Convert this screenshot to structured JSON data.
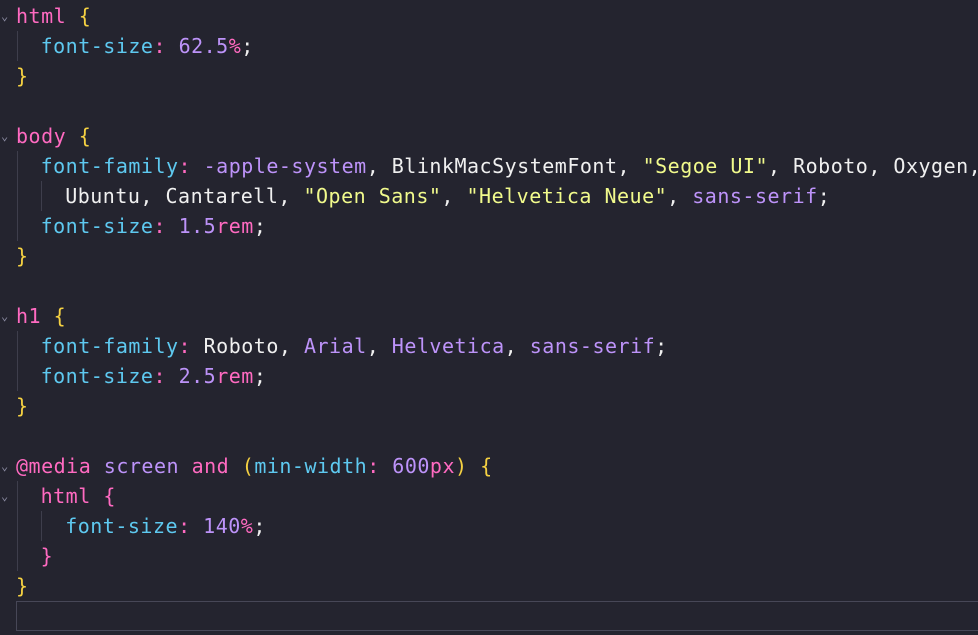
{
  "colors": {
    "background": "#24242f",
    "default": "#f0f0f0",
    "selector": "#ff6ac1",
    "brace": "#f5d142",
    "property": "#5ec9f0",
    "number": "#bd93f9",
    "unit": "#ff6ac1",
    "keyword": "#bd93f9",
    "string": "#f1fa8c",
    "at_rule": "#ff6ac1",
    "operator": "#ff6ac1",
    "paren": "#f5d142"
  },
  "lines": [
    {
      "indent": 0,
      "fold": true,
      "tokens": [
        {
          "t": "html",
          "k": "selector"
        },
        {
          "t": " "
        },
        {
          "t": "{",
          "k": "brace"
        }
      ]
    },
    {
      "indent": 1,
      "tokens": [
        {
          "t": "font-size",
          "k": "property"
        },
        {
          "t": ":",
          "k": "operator"
        },
        {
          "t": " "
        },
        {
          "t": "62.5",
          "k": "number"
        },
        {
          "t": "%",
          "k": "unit"
        },
        {
          "t": ";"
        }
      ]
    },
    {
      "indent": 0,
      "tokens": [
        {
          "t": "}",
          "k": "brace"
        }
      ]
    },
    {
      "indent": 0,
      "tokens": []
    },
    {
      "indent": 0,
      "fold": true,
      "tokens": [
        {
          "t": "body",
          "k": "selector"
        },
        {
          "t": " "
        },
        {
          "t": "{",
          "k": "brace"
        }
      ]
    },
    {
      "indent": 1,
      "tokens": [
        {
          "t": "font-family",
          "k": "property"
        },
        {
          "t": ":",
          "k": "operator"
        },
        {
          "t": " "
        },
        {
          "t": "-apple-system",
          "k": "keyword"
        },
        {
          "t": ", BlinkMacSystemFont, "
        },
        {
          "t": "\"Segoe UI\"",
          "k": "string"
        },
        {
          "t": ", Roboto, Oxygen,"
        }
      ]
    },
    {
      "indent": 2,
      "tokens": [
        {
          "t": "Ubuntu, Cantarell, "
        },
        {
          "t": "\"Open Sans\"",
          "k": "string"
        },
        {
          "t": ", "
        },
        {
          "t": "\"Helvetica Neue\"",
          "k": "string"
        },
        {
          "t": ", "
        },
        {
          "t": "sans-serif",
          "k": "keyword"
        },
        {
          "t": ";"
        }
      ]
    },
    {
      "indent": 1,
      "tokens": [
        {
          "t": "font-size",
          "k": "property"
        },
        {
          "t": ":",
          "k": "operator"
        },
        {
          "t": " "
        },
        {
          "t": "1.5",
          "k": "number"
        },
        {
          "t": "rem",
          "k": "unit"
        },
        {
          "t": ";"
        }
      ]
    },
    {
      "indent": 0,
      "tokens": [
        {
          "t": "}",
          "k": "brace"
        }
      ]
    },
    {
      "indent": 0,
      "tokens": []
    },
    {
      "indent": 0,
      "fold": true,
      "tokens": [
        {
          "t": "h1",
          "k": "selector"
        },
        {
          "t": " "
        },
        {
          "t": "{",
          "k": "brace"
        }
      ]
    },
    {
      "indent": 1,
      "tokens": [
        {
          "t": "font-family",
          "k": "property"
        },
        {
          "t": ":",
          "k": "operator"
        },
        {
          "t": " Roboto, "
        },
        {
          "t": "Arial",
          "k": "keyword"
        },
        {
          "t": ", "
        },
        {
          "t": "Helvetica",
          "k": "keyword"
        },
        {
          "t": ", "
        },
        {
          "t": "sans-serif",
          "k": "keyword"
        },
        {
          "t": ";"
        }
      ]
    },
    {
      "indent": 1,
      "tokens": [
        {
          "t": "font-size",
          "k": "property"
        },
        {
          "t": ":",
          "k": "operator"
        },
        {
          "t": " "
        },
        {
          "t": "2.5",
          "k": "number"
        },
        {
          "t": "rem",
          "k": "unit"
        },
        {
          "t": ";"
        }
      ]
    },
    {
      "indent": 0,
      "tokens": [
        {
          "t": "}",
          "k": "brace"
        }
      ]
    },
    {
      "indent": 0,
      "tokens": []
    },
    {
      "indent": 0,
      "fold": true,
      "tokens": [
        {
          "t": "@media",
          "k": "at_rule"
        },
        {
          "t": " "
        },
        {
          "t": "screen",
          "k": "keyword"
        },
        {
          "t": " "
        },
        {
          "t": "and",
          "k": "at_rule"
        },
        {
          "t": " "
        },
        {
          "t": "(",
          "k": "paren"
        },
        {
          "t": "min-width",
          "k": "property"
        },
        {
          "t": ":",
          "k": "operator"
        },
        {
          "t": " "
        },
        {
          "t": "600",
          "k": "number"
        },
        {
          "t": "px",
          "k": "unit"
        },
        {
          "t": ")",
          "k": "paren"
        },
        {
          "t": " "
        },
        {
          "t": "{",
          "k": "brace"
        }
      ]
    },
    {
      "indent": 1,
      "fold": true,
      "tokens": [
        {
          "t": "html",
          "k": "selector"
        },
        {
          "t": " "
        },
        {
          "t": "{",
          "k": "selector"
        }
      ]
    },
    {
      "indent": 2,
      "tokens": [
        {
          "t": "font-size",
          "k": "property"
        },
        {
          "t": ":",
          "k": "operator"
        },
        {
          "t": " "
        },
        {
          "t": "140",
          "k": "number"
        },
        {
          "t": "%",
          "k": "unit"
        },
        {
          "t": ";"
        }
      ]
    },
    {
      "indent": 1,
      "tokens": [
        {
          "t": "}",
          "k": "selector"
        }
      ]
    },
    {
      "indent": 0,
      "tokens": [
        {
          "t": "}",
          "k": "brace"
        }
      ]
    },
    {
      "indent": 0,
      "tokens": []
    }
  ]
}
